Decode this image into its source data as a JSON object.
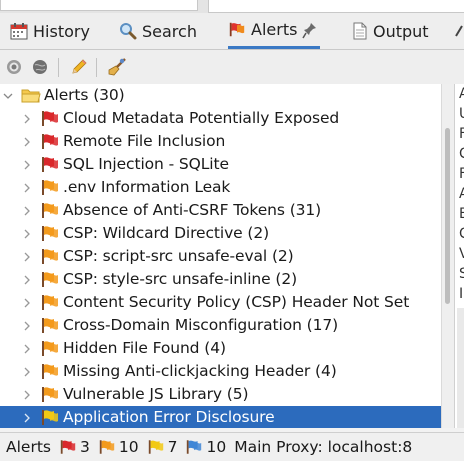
{
  "tabs": [
    {
      "label": "History",
      "icon": "history-calendar-icon"
    },
    {
      "label": "Search",
      "icon": "search-icon"
    },
    {
      "label": "Alerts",
      "icon": "alerts-flag-icon",
      "active": true
    },
    {
      "label": "Output",
      "icon": "document-icon"
    }
  ],
  "colors": {
    "selected_row": "#2c6bbd",
    "flag_high": "#d9282b",
    "flag_medium": "#f39a1c",
    "flag_low": "#f2c914",
    "flag_info": "#3f86d6",
    "folder": "#f5c94d"
  },
  "tree": {
    "root": {
      "label": "Alerts (30)",
      "icon": "folder-icon"
    },
    "items": [
      {
        "label": "Cloud Metadata Potentially Exposed",
        "risk": "high"
      },
      {
        "label": "Remote File Inclusion",
        "risk": "high"
      },
      {
        "label": "SQL Injection - SQLite",
        "risk": "high"
      },
      {
        "label": ".env Information Leak",
        "risk": "medium"
      },
      {
        "label": "Absence of Anti-CSRF Tokens (31)",
        "risk": "medium"
      },
      {
        "label": "CSP: Wildcard Directive (2)",
        "risk": "medium"
      },
      {
        "label": "CSP: script-src unsafe-eval (2)",
        "risk": "medium"
      },
      {
        "label": "CSP: style-src unsafe-inline (2)",
        "risk": "medium"
      },
      {
        "label": "Content Security Policy (CSP) Header Not Set",
        "risk": "medium"
      },
      {
        "label": "Cross-Domain Misconfiguration (17)",
        "risk": "medium"
      },
      {
        "label": "Hidden File Found (4)",
        "risk": "medium"
      },
      {
        "label": "Missing Anti-clickjacking Header (4)",
        "risk": "medium"
      },
      {
        "label": "Vulnerable JS Library (5)",
        "risk": "medium"
      },
      {
        "label": "Application Error Disclosure",
        "risk": "low",
        "selected": true
      }
    ]
  },
  "right_pane_letters": [
    "A",
    "U",
    "F",
    "C",
    "F",
    "A",
    "E",
    "C",
    "V",
    "S",
    "I"
  ],
  "status": {
    "alerts_label": "Alerts",
    "high_count": "3",
    "medium_count": "10",
    "low_count": "7",
    "info_count": "10",
    "proxy_text": "Main Proxy: localhost:8"
  }
}
